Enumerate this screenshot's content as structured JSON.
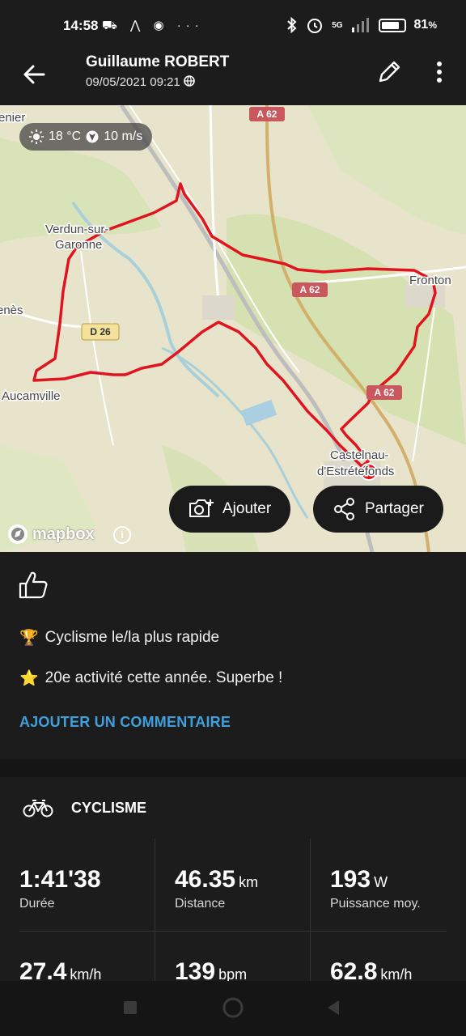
{
  "status_bar": {
    "time": "14:58",
    "icons_left": [
      "mail-icon",
      "strava-icon",
      "suunto-icon",
      "more-dots"
    ],
    "icons_left_text": "⛟ ⋀ ◉ ···",
    "network": "5G",
    "battery": "81",
    "battery_unit": "%",
    "battery_level": 0.81
  },
  "header": {
    "title": "Guillaume ROBERT",
    "date": "09/05/2021 09:21"
  },
  "map": {
    "weather_temp": "18 °C",
    "weather_wind": "10 m/s",
    "labels": {
      "verdun1": "Verdun-sur-",
      "verdun2": "Garonne",
      "fronton": "Fronton",
      "aucamville": "Aucamville",
      "castelnau1": "Castelnau-",
      "castelnau2": "d'Estrétefonds",
      "lenier": "enier",
      "enes": "enès",
      "a62_top": "A 62",
      "a62_mid": "A 62",
      "a62_low": "A 62",
      "d26": "D 26"
    },
    "add_button": "Ajouter",
    "share_button": "Partager",
    "attribution": "mapbox",
    "info": "i",
    "route_color": "#e0141e"
  },
  "social": {
    "achievements": [
      {
        "icon": "trophy-icon",
        "emoji": "🏆",
        "text": "Cyclisme le/la plus rapide"
      },
      {
        "icon": "star-icon",
        "emoji": "⭐",
        "text": "20e activité cette année. Superbe !"
      }
    ],
    "add_comment": "AJOUTER UN COMMENTAIRE",
    "comment_color": "#3fa0dc"
  },
  "stats": {
    "sport": "CYCLISME",
    "items": [
      {
        "value": "1:41'38",
        "unit": "",
        "label": "Durée"
      },
      {
        "value": "46.35",
        "unit": "km",
        "label": "Distance"
      },
      {
        "value": "193",
        "unit": "W",
        "label": "Puissance moy."
      },
      {
        "value": "27.4",
        "unit": "km/h",
        "label": ""
      },
      {
        "value": "139",
        "unit": "bpm",
        "label": ""
      },
      {
        "value": "62.8",
        "unit": "km/h",
        "label": ""
      }
    ]
  }
}
